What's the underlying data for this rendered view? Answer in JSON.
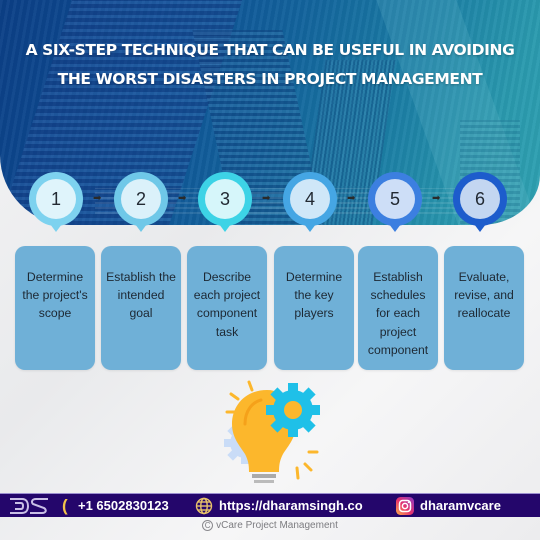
{
  "header": {
    "title_line1": "A SIX-STEP TECHNIQUE THAT CAN BE USEFUL IN AVOIDING",
    "title_line2": "THE WORST DISASTERS IN PROJECT MANAGEMENT"
  },
  "steps": [
    {
      "number": "1",
      "label": "Determine the project's scope",
      "ring_color": "#7dd2ef",
      "inner_color": "#dff4fb"
    },
    {
      "number": "2",
      "label": "Establish the intended goal",
      "ring_color": "#6fc8e8",
      "inner_color": "#dbf1fa"
    },
    {
      "number": "3",
      "label": "Describe each project component task",
      "ring_color": "#3dd3e6",
      "inner_color": "#d6f6fa"
    },
    {
      "number": "4",
      "label": "Determine the key players",
      "ring_color": "#45a6e4",
      "inner_color": "#cfe7f8"
    },
    {
      "number": "5",
      "label": "Establish schedules for each project component",
      "ring_color": "#3c7fe0",
      "inner_color": "#cddef7"
    },
    {
      "number": "6",
      "label": "Evaluate, revise, and reallocate",
      "ring_color": "#1d5ccc",
      "inner_color": "#c3d6f1"
    }
  ],
  "step_arrow_glyph": "➡",
  "illustration": {
    "icon": "lightbulb-with-gears-icon"
  },
  "footer": {
    "logo_text": "DS",
    "phone": "+1 6502830123",
    "website": "https://dharamsingh.co",
    "instagram": "dharamvcare",
    "copyright": "vCare Project Management",
    "copyright_symbol": "C"
  }
}
